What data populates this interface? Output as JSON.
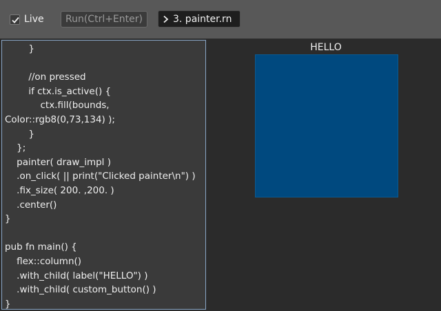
{
  "toolbar": {
    "live_label": "Live",
    "live_checked": true,
    "run_label": "Run(Ctrl+Enter)",
    "file_select_value": "3. painter.rn",
    "file_select_icon": "chevron-right-icon"
  },
  "editor": {
    "lines": [
      "        }",
      "",
      "        //on pressed",
      "        if ctx.is_active() {",
      "            ctx.fill(bounds,",
      "Color::rgb8(0,73,134) );",
      "        }",
      "    };",
      "    painter( draw_impl )",
      "    .on_click( || print(\"Clicked painter\\n\") )",
      "    .fix_size( 200. ,200. )",
      "    .center()",
      "}",
      "",
      "pub fn main() {",
      "    flex::column()",
      "    .with_child( label(\"HELLO\") )",
      "    .with_child( custom_button() )",
      "}"
    ]
  },
  "preview": {
    "label": "HELLO",
    "painter_color": "#00497f"
  }
}
